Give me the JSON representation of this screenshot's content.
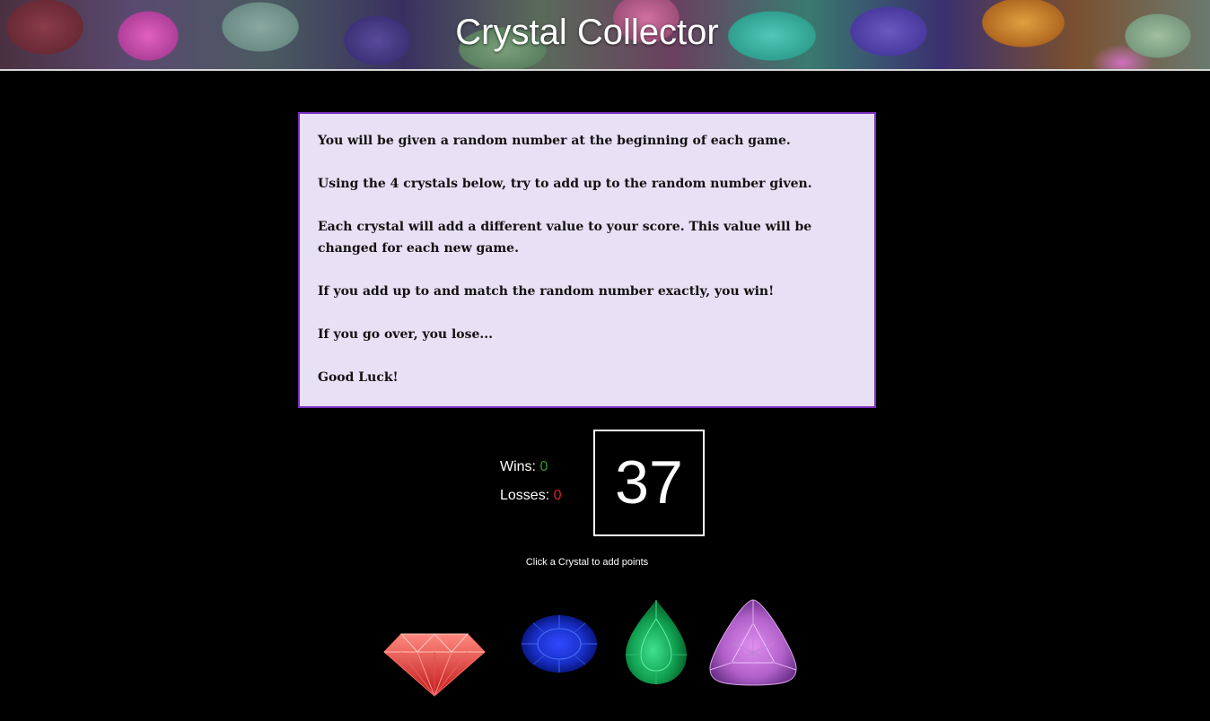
{
  "header": {
    "title": "Crystal Collector"
  },
  "instructions": [
    "You will be given a random number at the beginning of each game.",
    "Using the 4 crystals below, try to add up to the random number given.",
    "Each crystal will add a different value to your score. This value will be changed for each new game.",
    "If you add up to and match the random number exactly, you win!",
    "If you go over, you lose...",
    "Good Luck!"
  ],
  "scoreboard": {
    "wins_label": "Wins:",
    "wins_value": "0",
    "losses_label": "Losses:",
    "losses_value": "0"
  },
  "target_number": "37",
  "hint": "Click a Crystal to add points",
  "crystals": [
    {
      "name": "red-diamond",
      "color": "#e8403a"
    },
    {
      "name": "blue-sapphire",
      "color": "#1428c8"
    },
    {
      "name": "green-emerald",
      "color": "#18a050"
    },
    {
      "name": "purple-amethyst",
      "color": "#b060c8"
    }
  ]
}
